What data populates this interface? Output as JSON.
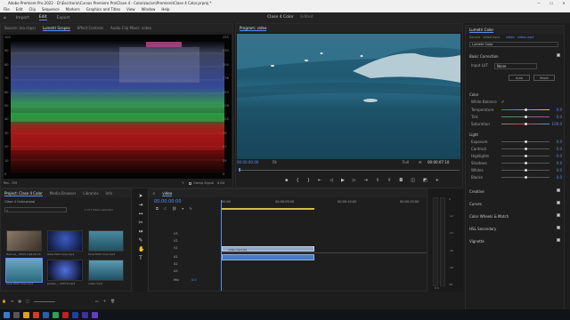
{
  "window": {
    "title": "Adobe Premiere Pro 2022 - D:\\Escritorio\\Cursos Premiere Pro\\Clase 4 - Colorizacion\\Premiere\\Clase 4 Color.prproj *",
    "controls": [
      "—",
      "☐",
      "✕"
    ]
  },
  "menu": [
    "File",
    "Edit",
    "Clip",
    "Sequence",
    "Markers",
    "Graphics and Titles",
    "View",
    "Window",
    "Help"
  ],
  "workspace": {
    "tabs": [
      "Import",
      "Edit",
      "Export"
    ],
    "active_tab": "Edit",
    "sequence_title": "Clase 4 Color",
    "sequence_sub": "Edited"
  },
  "source_panel": {
    "tabs": [
      "Source: (no clips)",
      "Lumetri Scopes",
      "Effect Controls",
      "Audio Clip Mixer: video"
    ],
    "active": "Lumetri Scopes",
    "scale_left": [
      "100",
      "90",
      "80",
      "70",
      "60",
      "50",
      "40",
      "30",
      "20",
      "10",
      "0"
    ],
    "scale_right": [
      "255",
      "230",
      "204",
      "178",
      "153",
      "128",
      "102",
      "76",
      "51",
      "25",
      "0"
    ],
    "footer_left": "Rec. 709",
    "footer_clamp": "Clamp Signal",
    "footer_bits": "8 Bit"
  },
  "program": {
    "title": "Program: video",
    "timecode_in": "00:00:00:00",
    "fit": "Fit",
    "quality": "Full",
    "timecode_out": "00:00:07:10"
  },
  "lumetri": {
    "title": "Lumetri Color",
    "source_row": "Source · video.mp4",
    "target_row": "video · video.mp4",
    "dropdown": "Lumetri Color",
    "basic_correction": "Basic Correction",
    "input_lut_label": "Input LUT",
    "input_lut_value": "None",
    "auto_btn": "Auto",
    "reset_btn": "Reset",
    "color_section": "Color",
    "white_balance": "White Balance",
    "color_sliders": [
      {
        "label": "Temperature",
        "value": "0.0",
        "pos": 0.5
      },
      {
        "label": "Tint",
        "value": "0.0",
        "pos": 0.5
      },
      {
        "label": "Saturation",
        "value": "100.0",
        "pos": 0.5
      }
    ],
    "light_section": "Light",
    "light_sliders": [
      {
        "label": "Exposure",
        "value": "0.0",
        "pos": 0.5
      },
      {
        "label": "Contrast",
        "value": "0.0",
        "pos": 0.5
      },
      {
        "label": "Highlights",
        "value": "0.0",
        "pos": 0.5
      },
      {
        "label": "Shadows",
        "value": "0.0",
        "pos": 0.5
      },
      {
        "label": "Whites",
        "value": "0.0",
        "pos": 0.5
      },
      {
        "label": "Blacks",
        "value": "0.0",
        "pos": 0.5
      }
    ],
    "sections": [
      "Creative",
      "Curves",
      "Color Wheels & Match",
      "HSL Secondary",
      "Vignette"
    ]
  },
  "project": {
    "tabs": [
      "Project: Clase 4 Color",
      "Media Browser",
      "Libraries",
      "Info"
    ],
    "active": "Project: Clase 4 Color",
    "file": "Clase 4 Color.prproj",
    "count": "1 of 7 items selected",
    "items": [
      {
        "label": "Haircut_..0003.mp4",
        "dur": "20:15"
      },
      {
        "label": "Slow Mott Cine.mp4",
        "dur": ""
      },
      {
        "label": "Slow Mott Cine.mp4",
        "dur": ""
      },
      {
        "label": "Slow Mott Cine.mp4",
        "dur": ""
      },
      {
        "label": "pexels_...43073.mp4",
        "dur": ""
      },
      {
        "label": "video.mp4",
        "dur": ""
      },
      {
        "label": "",
        "dur": ""
      }
    ]
  },
  "timeline": {
    "tab": "video",
    "timecode": "00:00:00:00",
    "ruler": [
      "00:00",
      "00:00:05:00",
      "00:00:10:00",
      "00:00:15:00"
    ],
    "tracks": [
      "V3",
      "V2",
      "V1",
      "A1",
      "A2",
      "A3",
      "Mix"
    ],
    "clip_label": "video.mp4 [V]",
    "mix_value": "0.0"
  },
  "meters": {
    "scale": [
      "0",
      "-12",
      "-24",
      "-36",
      "-48",
      "dB"
    ],
    "footer": "S S"
  }
}
